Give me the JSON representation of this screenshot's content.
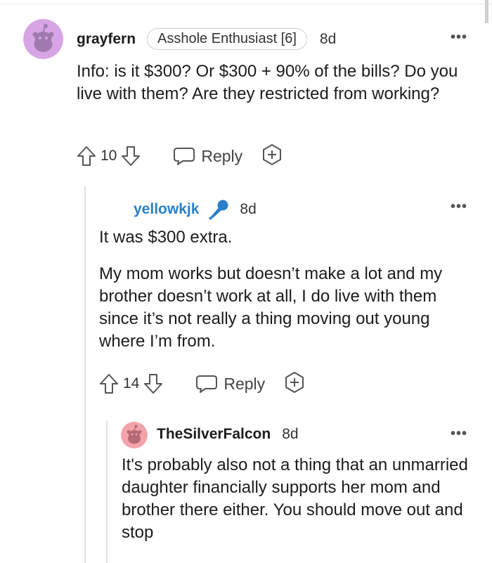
{
  "comments": [
    {
      "username": "grayfern",
      "flair": "Asshole Enthusiast [6]",
      "time": "8d",
      "body": [
        "Info: is it $300? Or $300 + 90% of the bills? Do you live with them? Are they restricted from working?"
      ],
      "score": "10",
      "reply_label": "Reply",
      "avatar_color": "#d7a5e6"
    },
    {
      "username": "yellowkjk",
      "time": "8d",
      "username_color": "#2a80c8",
      "body": [
        "It was $300 extra.",
        "My mom works but doesn’t make a lot and my brother doesn’t work at all, I do live with them since it’s not really a thing moving out young where I’m from."
      ],
      "score": "14",
      "reply_label": "Reply"
    },
    {
      "username": "TheSilverFalcon",
      "time": "8d",
      "body": [
        "It's probably also not a thing that an unmarried daughter financially supports her mom and brother there either. You should move out and stop"
      ],
      "avatar_color": "#f4a3ab"
    }
  ],
  "more_glyph": "•••",
  "icons": [
    "snoo-avatar-icon",
    "upvote-icon",
    "downvote-icon",
    "reply-bubble-icon",
    "award-plus-icon",
    "microphone-icon",
    "more-options-icon"
  ]
}
